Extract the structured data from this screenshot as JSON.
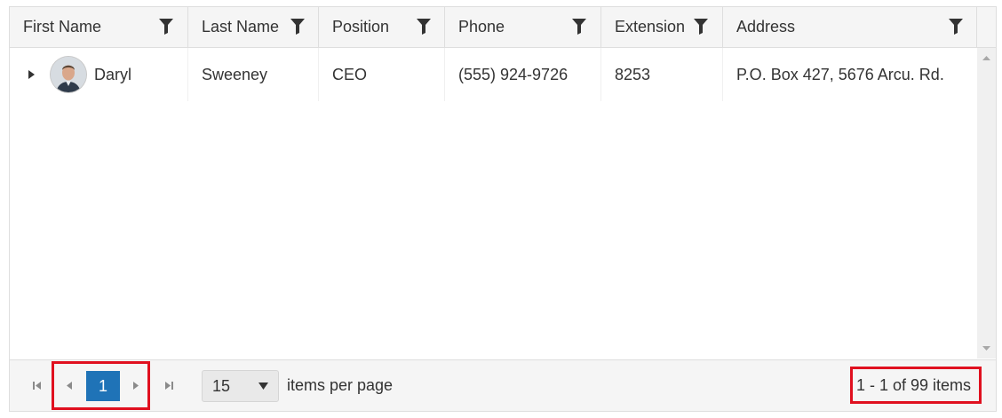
{
  "columns": [
    {
      "label": "First Name"
    },
    {
      "label": "Last Name"
    },
    {
      "label": "Position"
    },
    {
      "label": "Phone"
    },
    {
      "label": "Extension"
    },
    {
      "label": "Address"
    }
  ],
  "rows": [
    {
      "first_name": "Daryl",
      "last_name": "Sweeney",
      "position": "CEO",
      "phone": "(555) 924-9726",
      "extension": "8253",
      "address": "P.O. Box 427, 5676 Arcu. Rd."
    }
  ],
  "pager": {
    "current_page": "1",
    "page_size": "15",
    "items_per_page_label": "items per page",
    "info": "1 - 1 of 99 items"
  },
  "colors": {
    "accent": "#1f73b7",
    "highlight": "#e0101f",
    "header_bg": "#f5f5f5"
  }
}
